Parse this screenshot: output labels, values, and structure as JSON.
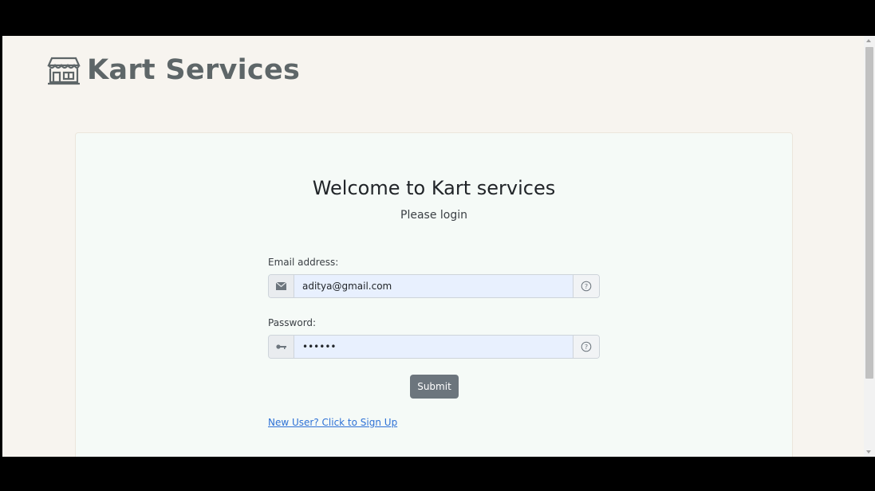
{
  "brand": {
    "title": "Kart Services",
    "icon": "shop-icon"
  },
  "login": {
    "heading": "Welcome to Kart services",
    "subheading": "Please login",
    "email": {
      "label": "Email address:",
      "value": "aditya@gmail.com",
      "prefix_icon": "envelope-icon",
      "suffix_icon": "help-icon"
    },
    "password": {
      "label": "Password:",
      "value": "aditya",
      "prefix_icon": "key-icon",
      "suffix_icon": "help-icon"
    },
    "submit_label": "Submit",
    "signup_link": "New User? Click to Sign Up"
  },
  "colors": {
    "page_bg": "#f7f4ef",
    "card_bg": "#f5faf7",
    "brand_text": "#5e6668",
    "button_bg": "#6c757d",
    "input_bg": "#e8f0fe",
    "link": "#2f72d6"
  }
}
